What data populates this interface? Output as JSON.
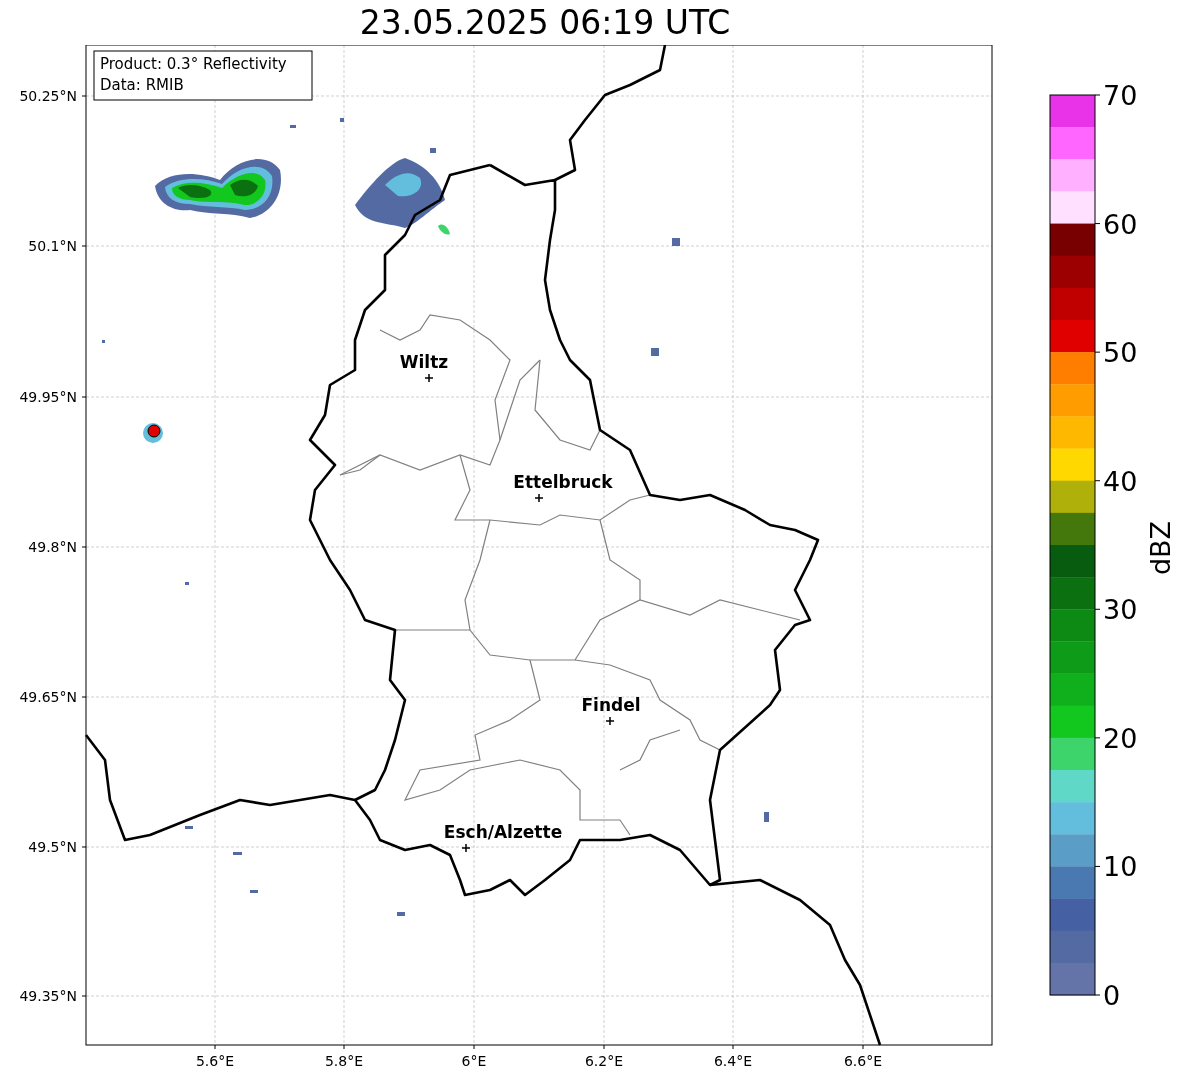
{
  "title": "23.05.2025 06:19 UTC",
  "map": {
    "info": [
      "Product: 0.3° Reflectivity",
      "Data: RMIB"
    ],
    "lat_ticks": [
      "50.25°N",
      "50.1°N",
      "49.95°N",
      "49.8°N",
      "49.65°N",
      "49.5°N",
      "49.35°N"
    ],
    "lon_ticks": [
      "5.6°E",
      "5.8°E",
      "6°E",
      "6.2°E",
      "6.4°E",
      "6.6°E"
    ],
    "cities": [
      {
        "name": "Wiltz"
      },
      {
        "name": "Ettelbruck"
      },
      {
        "name": "Findel"
      },
      {
        "name": "Esch/Alzette"
      }
    ]
  },
  "colorbar": {
    "label": "dBZ",
    "ticks": [
      "70",
      "60",
      "50",
      "40",
      "30",
      "20",
      "10",
      "0"
    ],
    "bins": [
      {
        "color": "#e833e8"
      },
      {
        "color": "#ff66ff"
      },
      {
        "color": "#ffb0ff"
      },
      {
        "color": "#ffe0ff"
      },
      {
        "color": "#780000"
      },
      {
        "color": "#9c0000"
      },
      {
        "color": "#c00000"
      },
      {
        "color": "#e00000"
      },
      {
        "color": "#ff7e00"
      },
      {
        "color": "#ff9c00"
      },
      {
        "color": "#ffb800"
      },
      {
        "color": "#ffd800"
      },
      {
        "color": "#b0b00a"
      },
      {
        "color": "#44780c"
      },
      {
        "color": "#085c10"
      },
      {
        "color": "#0a7010"
      },
      {
        "color": "#0c8a14"
      },
      {
        "color": "#0e9c18"
      },
      {
        "color": "#10b01c"
      },
      {
        "color": "#12c81e"
      },
      {
        "color": "#3dd46c"
      },
      {
        "color": "#60d8c8"
      },
      {
        "color": "#62bedc"
      },
      {
        "color": "#5a9ec8"
      },
      {
        "color": "#4a78b0"
      },
      {
        "color": "#4560a3"
      },
      {
        "color": "#546aa3"
      },
      {
        "color": "#6473a8"
      }
    ]
  }
}
